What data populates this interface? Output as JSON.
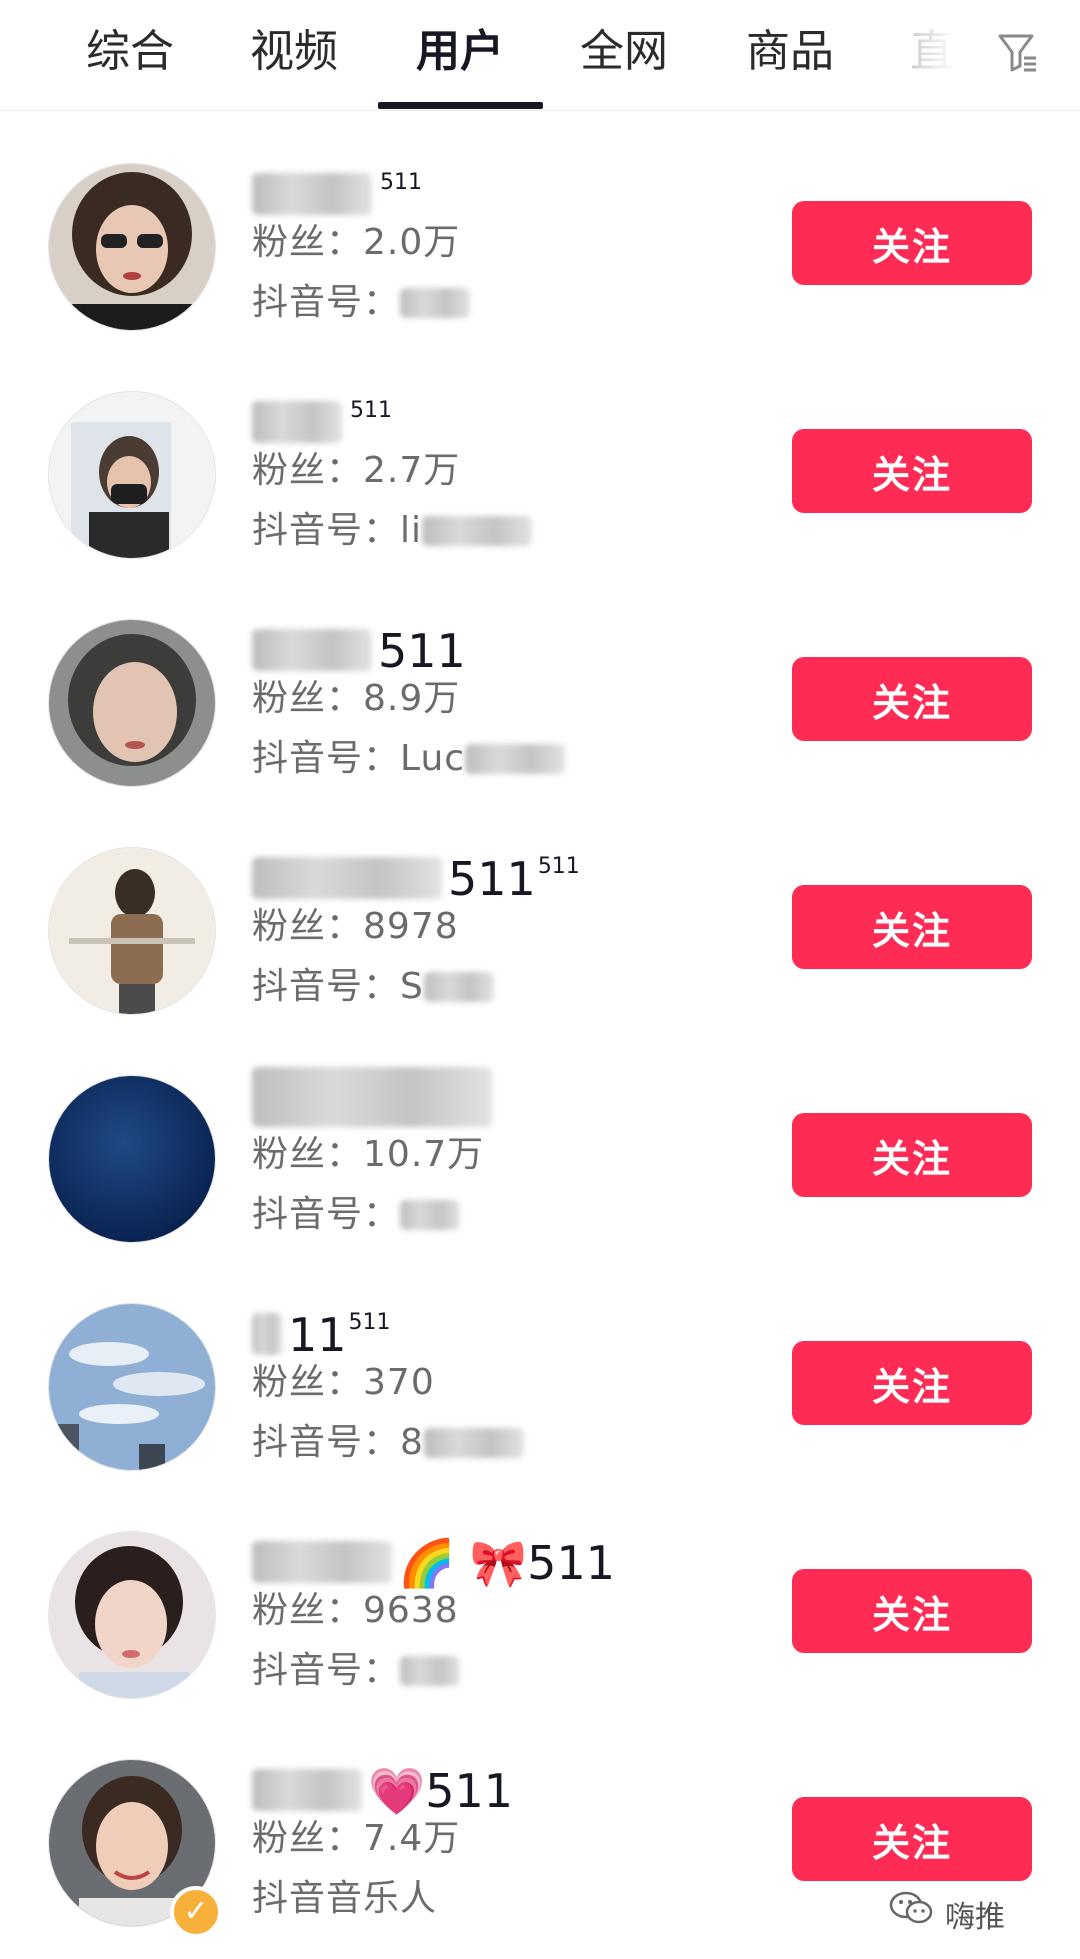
{
  "tabs": [
    {
      "label": "综合",
      "active": false
    },
    {
      "label": "视频",
      "active": false
    },
    {
      "label": "用户",
      "active": true
    },
    {
      "label": "全网",
      "active": false
    },
    {
      "label": "商品",
      "active": false
    },
    {
      "label": "直",
      "active": false
    }
  ],
  "filter_icon": "filter-icon",
  "users": [
    {
      "name_visible": "",
      "sup": "511",
      "fans_label": "粉丝：",
      "fans": "2.0万",
      "id_label": "抖音号：",
      "id_value": "",
      "follow_label": "关注"
    },
    {
      "name_visible": "",
      "sup": "511",
      "fans_label": "粉丝：",
      "fans": "2.7万",
      "id_label": "抖音号：",
      "id_value": "li",
      "follow_label": "关注"
    },
    {
      "name_visible": "511",
      "sup": "",
      "fans_label": "粉丝：",
      "fans": "8.9万",
      "id_label": "抖音号：",
      "id_value": "Luc",
      "follow_label": "关注"
    },
    {
      "name_visible": "511",
      "sup": "511",
      "fans_label": "粉丝：",
      "fans": "8978",
      "id_label": "抖音号：",
      "id_value": "S",
      "follow_label": "关注"
    },
    {
      "name_visible": "",
      "sup": "",
      "fans_label": "粉丝：",
      "fans": "10.7万",
      "id_label": "抖音号：",
      "id_value": "",
      "follow_label": "关注"
    },
    {
      "name_visible": "11",
      "sup": "511",
      "fans_label": "粉丝：",
      "fans": "370",
      "id_label": "抖音号：",
      "id_value": "8",
      "follow_label": "关注"
    },
    {
      "name_visible": "🌈 🎀511",
      "sup": "",
      "fans_label": "粉丝：",
      "fans": "9638",
      "id_label": "抖音号：",
      "id_value": "",
      "follow_label": "关注"
    },
    {
      "name_visible": "💗511",
      "sup": "",
      "fans_label": "粉丝：",
      "fans": "7.4万",
      "id_label": "抖音音乐人",
      "id_value": "",
      "follow_label": "关注",
      "verified": true
    }
  ],
  "watermark": {
    "text": "嗨推",
    "icon": "wechat-icon"
  },
  "colors": {
    "accent": "#fe2c55",
    "text": "#161823",
    "muted": "#6b6b6b",
    "verified": "#f7b13a"
  }
}
